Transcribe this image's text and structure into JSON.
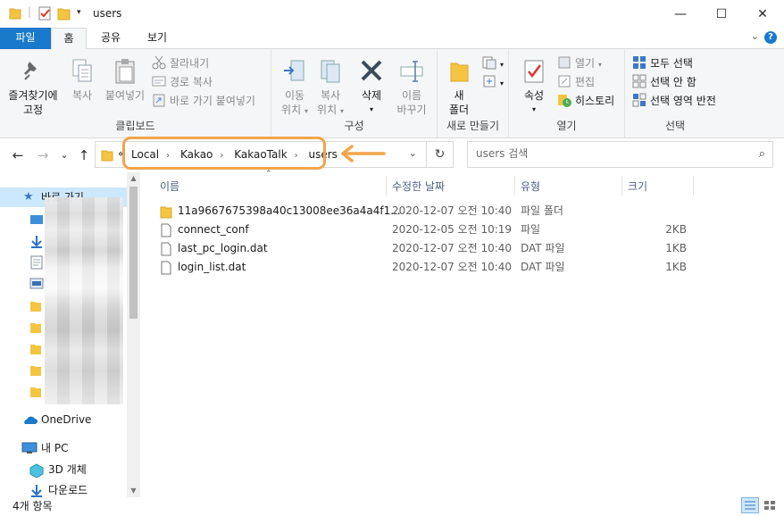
{
  "window": {
    "title": "users",
    "minimize_glyph": "—",
    "maximize_glyph": "☐",
    "close_glyph": "✕"
  },
  "ribbon_tabs": {
    "file": "파일",
    "home": "홈",
    "share": "공유",
    "view": "보기",
    "help_glyph": "?"
  },
  "ribbon": {
    "clipboard": {
      "label": "클립보드",
      "pin_line1": "즐겨찾기에",
      "pin_line2": "고정",
      "copy": "복사",
      "paste": "붙여넣기",
      "cut": "잘라내기",
      "copy_path": "경로 복사",
      "paste_shortcut": "바로 가기 붙여넣기"
    },
    "organize": {
      "label": "구성",
      "move_line1": "이동",
      "move_line2": "위치",
      "copyto_line1": "복사",
      "copyto_line2": "위치",
      "delete": "삭제",
      "rename_line1": "이름",
      "rename_line2": "바꾸기"
    },
    "new": {
      "label": "새로 만들기",
      "new_folder_line1": "새",
      "new_folder_line2": "폴더"
    },
    "open": {
      "label": "열기",
      "properties": "속성",
      "open": "열기",
      "edit": "편집",
      "history": "히스토리"
    },
    "select": {
      "label": "선택",
      "select_all": "모두 선택",
      "select_none": "선택 안 함",
      "invert": "선택 영역 반전"
    }
  },
  "navigation": {
    "back_glyph": "←",
    "forward_glyph": "→",
    "dropdown_glyph": "⌄",
    "up_glyph": "↑",
    "overflow": "«",
    "breadcrumbs": [
      "Local",
      "Kakao",
      "KakaoTalk",
      "users"
    ],
    "search_placeholder": "users 검색"
  },
  "sidebar": {
    "quick_access": "바로 가기",
    "onedrive": "OneDrive",
    "this_pc": "내 PC",
    "objects_3d": "3D 개체",
    "downloads": "다운로드"
  },
  "columns": {
    "name": "이름",
    "date": "수정한 날짜",
    "type": "유형",
    "size": "크기"
  },
  "files": [
    {
      "name": "11a9667675398a40c13008ee36a4a4f1...",
      "date": "2020-12-07 오전 10:40",
      "type": "파일 폴더",
      "size": "",
      "icon": "folder-icon"
    },
    {
      "name": "connect_conf",
      "date": "2020-12-05 오전 10:19",
      "type": "파일",
      "size": "2KB",
      "icon": "file-icon"
    },
    {
      "name": "last_pc_login.dat",
      "date": "2020-12-07 오전 10:40",
      "type": "DAT 파일",
      "size": "1KB",
      "icon": "file-icon"
    },
    {
      "name": "login_list.dat",
      "date": "2020-12-07 오전 10:40",
      "type": "DAT 파일",
      "size": "1KB",
      "icon": "file-icon"
    }
  ],
  "status": {
    "item_count": "4개 항목"
  },
  "colors": {
    "accent": "#1979ca",
    "highlight": "#f2a54a",
    "folder": "#f4c542",
    "selection": "#cce8ff"
  }
}
